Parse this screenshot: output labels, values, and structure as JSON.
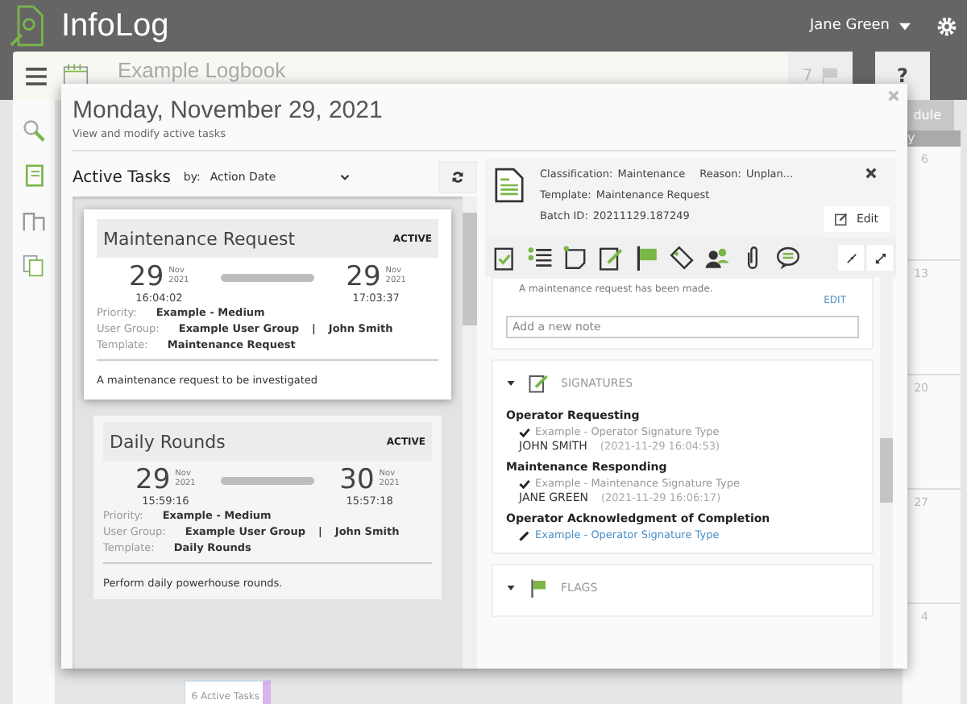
{
  "app": {
    "title": "InfoLog",
    "user": "Jane Green",
    "logbook": "Example Logbook",
    "flag_count": "7",
    "help": "?",
    "schedule_button": "dule",
    "calendar_header": "y",
    "calendar_days": [
      "6",
      "13",
      "20",
      "27",
      "4"
    ],
    "footer_count": "6 Active Tasks"
  },
  "dialog": {
    "title": "Monday, November 29, 2021",
    "subtitle": "View and modify active tasks"
  },
  "tasks_panel": {
    "title": "Active Tasks",
    "sort_label": "by:",
    "sort_value": "Action Date"
  },
  "tasks": [
    {
      "title": "Maintenance Request",
      "status": "ACTIVE",
      "selected": true,
      "start": {
        "day": "29",
        "month": "Nov",
        "year": "2021",
        "time": "16:04:02"
      },
      "end": {
        "day": "29",
        "month": "Nov",
        "year": "2021",
        "time": "17:03:37"
      },
      "priority_label": "Priority:",
      "priority": "Example - Medium",
      "group_label": "User Group:",
      "group": "Example User Group",
      "separator": "|",
      "user": "John Smith",
      "template_label": "Template:",
      "template": "Maintenance Request",
      "description": "A maintenance request to be investigated"
    },
    {
      "title": "Daily Rounds",
      "status": "ACTIVE",
      "selected": false,
      "start": {
        "day": "29",
        "month": "Nov",
        "year": "2021",
        "time": "15:59:16"
      },
      "end": {
        "day": "30",
        "month": "Nov",
        "year": "2021",
        "time": "15:57:18"
      },
      "priority_label": "Priority:",
      "priority": "Example - Medium",
      "group_label": "User Group:",
      "group": "Example User Group",
      "separator": "|",
      "user": "John Smith",
      "template_label": "Template:",
      "template": "Daily Rounds",
      "description": "Perform daily powerhouse rounds."
    }
  ],
  "detail": {
    "classification_label": "Classification:",
    "classification": "Maintenance",
    "reason_label": "Reason:",
    "reason": "Unplan...",
    "template_label": "Template:",
    "template": "Maintenance Request",
    "batch_label": "Batch ID:",
    "batch": "20211129.187249",
    "edit_button": "Edit",
    "note_text": "A maintenance request has been made.",
    "note_edit": "EDIT",
    "note_placeholder": "Add a new note"
  },
  "sections": [
    {
      "title": "SIGNATURES",
      "kind": "signatures",
      "expanded": true
    },
    {
      "title": "FLAGS",
      "kind": "flags",
      "expanded": true
    }
  ],
  "signatures": [
    {
      "role": "Operator Requesting",
      "type": "Example - Operator Signature Type",
      "signed": true,
      "signer": "JOHN SMITH",
      "timestamp": "(2021-11-29 16:04:53)"
    },
    {
      "role": "Maintenance Responding",
      "type": "Example - Maintenance Signature Type",
      "signed": true,
      "signer": "JANE GREEN",
      "timestamp": "(2021-11-29 16:06:17)"
    },
    {
      "role": "Operator Acknowledgment of Completion",
      "type": "Example - Operator Signature Type",
      "signed": false
    }
  ]
}
